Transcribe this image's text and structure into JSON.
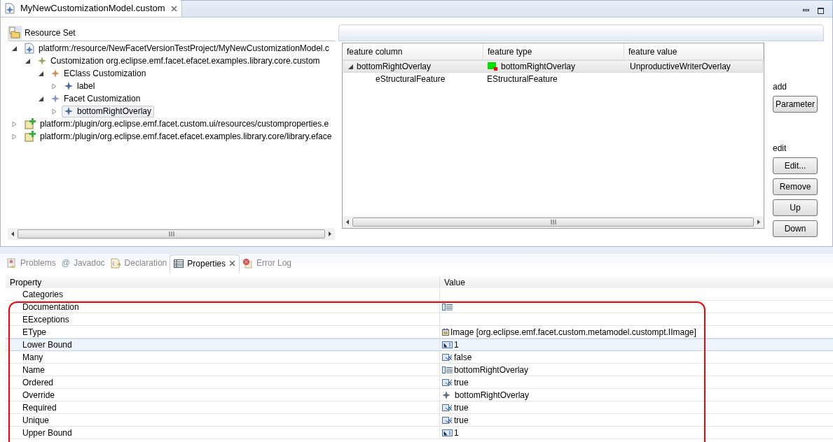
{
  "editor_tab": {
    "title": "MyNewCustomizationModel.custom"
  },
  "resource_set": {
    "title": "Resource Set"
  },
  "tree": [
    {
      "label": "platform:/resource/NewFacetVersionTestProject/MyNewCustomizationModel.c",
      "kind": "model",
      "expanded": true,
      "selected": false,
      "children": [
        {
          "label": "Customization org.eclipse.emf.facet.efacet.examples.library.core.custom",
          "kind": "custom",
          "expanded": true,
          "selected": false,
          "children": [
            {
              "label": "EClass Customization",
              "kind": "eclass",
              "expanded": true,
              "selected": false,
              "children": [
                {
                  "label": "label",
                  "kind": "item",
                  "expanded": false,
                  "selected": false
                }
              ]
            },
            {
              "label": "Facet Customization",
              "kind": "facet",
              "expanded": true,
              "selected": false,
              "children": [
                {
                  "label": "bottomRightOverlay",
                  "kind": "item",
                  "expanded": false,
                  "selected": true
                }
              ]
            }
          ]
        }
      ]
    },
    {
      "label": "platform:/plugin/org.eclipse.emf.facet.custom.ui/resources/customproperties.e",
      "kind": "plugin",
      "expanded": false,
      "selected": false
    },
    {
      "label": "platform:/plugin/org.eclipse.emf.facet.efacet.examples.library.core/library.eface",
      "kind": "plugin",
      "expanded": false,
      "selected": false
    }
  ],
  "feature_table": {
    "columns": [
      "feature column",
      "feature type",
      "feature value"
    ],
    "rows": [
      {
        "cells": [
          "bottomRightOverlay",
          "bottomRightOverlay",
          "UnproductiveWriterOverlay"
        ],
        "expanded": true,
        "selected": true,
        "has_image": true
      },
      {
        "cells": [
          "eStructuralFeature",
          "EStructuralFeature",
          null
        ],
        "selected": false,
        "has_image": false
      }
    ]
  },
  "side_buttons": {
    "add_label": "add",
    "add": [
      "Parameter"
    ],
    "edit_label": "edit",
    "edit": [
      "Edit...",
      "Remove",
      "Up",
      "Down"
    ]
  },
  "view_tabs": [
    {
      "label": "Problems",
      "kind": "problems",
      "selected": false
    },
    {
      "label": "Javadoc",
      "kind": "javadoc",
      "icon_text": "@",
      "selected": false
    },
    {
      "label": "Declaration",
      "kind": "declaration",
      "selected": false
    },
    {
      "label": "Properties",
      "kind": "properties",
      "selected": true
    },
    {
      "label": "Error Log",
      "kind": "error",
      "selected": false
    }
  ],
  "properties": {
    "columns": [
      "Property",
      "Value"
    ],
    "rows": [
      {
        "property": "Categories",
        "value": null,
        "kind": "none",
        "selected": false
      },
      {
        "property": "Documentation",
        "value": null,
        "kind": "text",
        "selected": false
      },
      {
        "property": "EExceptions",
        "value": null,
        "kind": "none",
        "selected": false
      },
      {
        "property": "EType",
        "value": "Image [org.eclipse.emf.facet.custom.metamodel.custompt.IImage]",
        "kind": "type",
        "selected": false
      },
      {
        "property": "Lower Bound",
        "value": "1",
        "kind": "number",
        "selected": true
      },
      {
        "property": "Many",
        "value": "false",
        "kind": "bool",
        "selected": false
      },
      {
        "property": "Name",
        "value": "bottomRightOverlay",
        "kind": "text",
        "selected": false
      },
      {
        "property": "Ordered",
        "value": "true",
        "kind": "bool",
        "selected": false
      },
      {
        "property": "Override",
        "value": "bottomRightOverlay",
        "kind": "element",
        "selected": false
      },
      {
        "property": "Required",
        "value": "true",
        "kind": "bool",
        "selected": false
      },
      {
        "property": "Unique",
        "value": "true",
        "kind": "bool",
        "selected": false
      },
      {
        "property": "Upper Bound",
        "value": "1",
        "kind": "number",
        "selected": false
      }
    ]
  }
}
